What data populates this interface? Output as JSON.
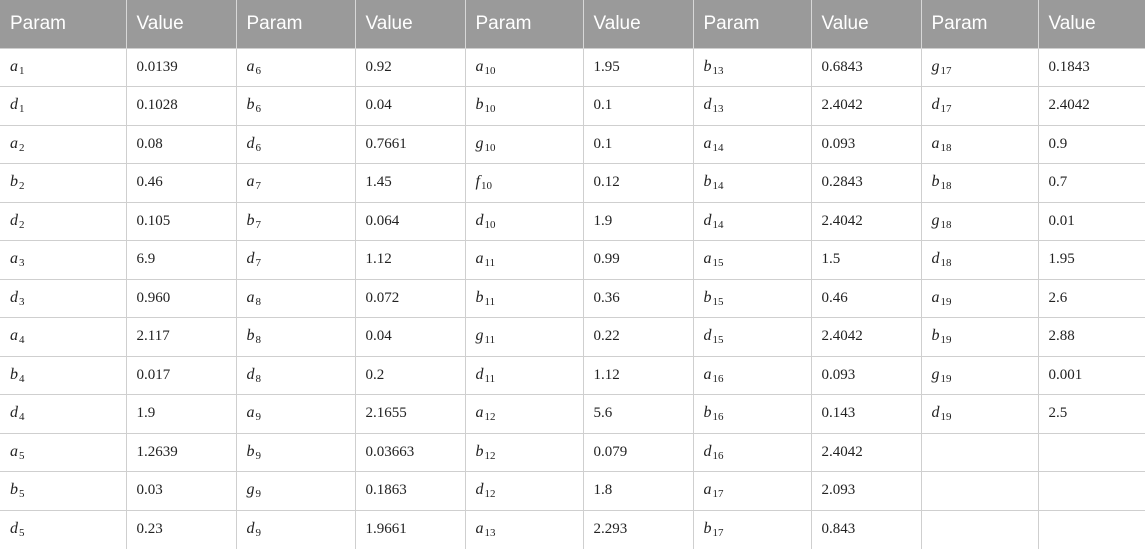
{
  "headers": [
    "Param",
    "Value",
    "Param",
    "Value",
    "Param",
    "Value",
    "Param",
    "Value",
    "Param",
    "Value"
  ],
  "rows": [
    [
      [
        "a",
        "1"
      ],
      "0.0139",
      [
        "a",
        "6"
      ],
      "0.92",
      [
        "a",
        "10"
      ],
      "1.95",
      [
        "b",
        "13"
      ],
      "0.6843",
      [
        "g",
        "17"
      ],
      "0.1843"
    ],
    [
      [
        "d",
        "1"
      ],
      "0.1028",
      [
        "b",
        "6"
      ],
      "0.04",
      [
        "b",
        "10"
      ],
      "0.1",
      [
        "d",
        "13"
      ],
      "2.4042",
      [
        "d",
        "17"
      ],
      "2.4042"
    ],
    [
      [
        "a",
        "2"
      ],
      "0.08",
      [
        "d",
        "6"
      ],
      "0.7661",
      [
        "g",
        "10"
      ],
      "0.1",
      [
        "a",
        "14"
      ],
      "0.093",
      [
        "a",
        "18"
      ],
      "0.9"
    ],
    [
      [
        "b",
        "2"
      ],
      "0.46",
      [
        "a",
        "7"
      ],
      "1.45",
      [
        "f",
        "10"
      ],
      "0.12",
      [
        "b",
        "14"
      ],
      "0.2843",
      [
        "b",
        "18"
      ],
      "0.7"
    ],
    [
      [
        "d",
        "2"
      ],
      "0.105",
      [
        "b",
        "7"
      ],
      "0.064",
      [
        "d",
        "10"
      ],
      "1.9",
      [
        "d",
        "14"
      ],
      "2.4042",
      [
        "g",
        "18"
      ],
      "0.01"
    ],
    [
      [
        "a",
        "3"
      ],
      "6.9",
      [
        "d",
        "7"
      ],
      "1.12",
      [
        "a",
        "11"
      ],
      "0.99",
      [
        "a",
        "15"
      ],
      "1.5",
      [
        "d",
        "18"
      ],
      "1.95"
    ],
    [
      [
        "d",
        "3"
      ],
      "0.960",
      [
        "a",
        "8"
      ],
      "0.072",
      [
        "b",
        "11"
      ],
      "0.36",
      [
        "b",
        "15"
      ],
      "0.46",
      [
        "a",
        "19"
      ],
      "2.6"
    ],
    [
      [
        "a",
        "4"
      ],
      "2.117",
      [
        "b",
        "8"
      ],
      "0.04",
      [
        "g",
        "11"
      ],
      "0.22",
      [
        "d",
        "15"
      ],
      "2.4042",
      [
        "b",
        "19"
      ],
      "2.88"
    ],
    [
      [
        "b",
        "4"
      ],
      "0.017",
      [
        "d",
        "8"
      ],
      "0.2",
      [
        "d",
        "11"
      ],
      "1.12",
      [
        "a",
        "16"
      ],
      "0.093",
      [
        "g",
        "19"
      ],
      "0.001"
    ],
    [
      [
        "d",
        "4"
      ],
      "1.9",
      [
        "a",
        "9"
      ],
      "2.1655",
      [
        "a",
        "12"
      ],
      "5.6",
      [
        "b",
        "16"
      ],
      "0.143",
      [
        "d",
        "19"
      ],
      "2.5"
    ],
    [
      [
        "a",
        "5"
      ],
      "1.2639",
      [
        "b",
        "9"
      ],
      "0.03663",
      [
        "b",
        "12"
      ],
      "0.079",
      [
        "d",
        "16"
      ],
      "2.4042",
      [
        "",
        ""
      ],
      ""
    ],
    [
      [
        "b",
        "5"
      ],
      "0.03",
      [
        "g",
        "9"
      ],
      "0.1863",
      [
        "d",
        "12"
      ],
      "1.8",
      [
        "a",
        "17"
      ],
      "2.093",
      [
        "",
        ""
      ],
      ""
    ],
    [
      [
        "d",
        "5"
      ],
      "0.23",
      [
        "d",
        "9"
      ],
      "1.9661",
      [
        "a",
        "13"
      ],
      "2.293",
      [
        "b",
        "17"
      ],
      "0.843",
      [
        "",
        ""
      ],
      ""
    ]
  ]
}
